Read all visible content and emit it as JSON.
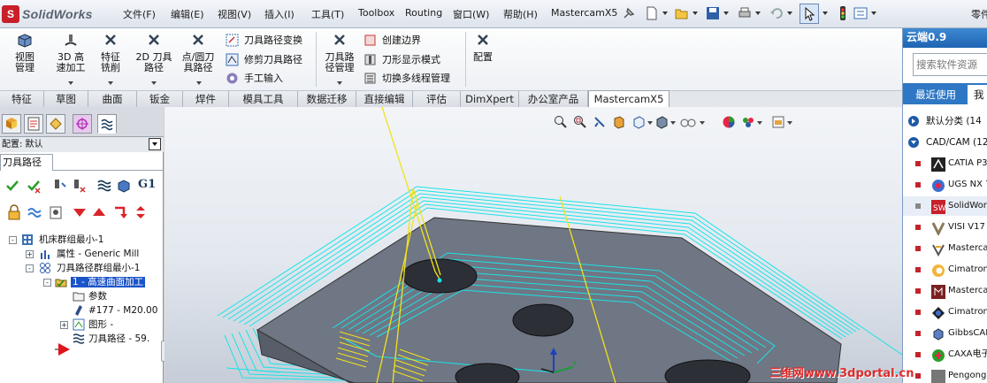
{
  "app": {
    "logo_text": "SolidWorks"
  },
  "menubar": {
    "items": [
      "文件(F)",
      "编辑(E)",
      "视图(V)",
      "插入(I)",
      "工具(T)",
      "Toolbox",
      "Routing",
      "窗口(W)",
      "帮助(H)",
      "MastercamX5"
    ],
    "right_cut_text": "零件"
  },
  "command_manager": {
    "big_buttons": [
      "视图管理",
      "3D 高速加工",
      "特征铣削",
      "2D 刀具路径",
      "点/圆刀具路径",
      "刀具路径管理",
      "配置"
    ],
    "small_buttons": [
      "刀具路径变换",
      "修剪刀具路径",
      "手工输入",
      "创建边界",
      "刀形显示模式",
      "切换多线程管理"
    ]
  },
  "tabs": [
    "特征",
    "草图",
    "曲面",
    "钣金",
    "焊件",
    "模具工具",
    "数据迁移",
    "直接编辑",
    "评估",
    "DimXpert",
    "办公室产品",
    "MastercamX5"
  ],
  "active_tab": "MastercamX5",
  "left_panel": {
    "config_label": "配置: 默认",
    "op_tab_label": "刀具路径",
    "tree": [
      {
        "label": "机床群组最小-1",
        "icon": "machine-group-icon"
      },
      {
        "label": "属性 - Generic Mill",
        "icon": "properties-icon"
      },
      {
        "label": "刀具路径群组最小-1",
        "icon": "toolpath-group-icon"
      },
      {
        "label": "1 - 高速曲面加工",
        "icon": "operation-folder-icon"
      },
      {
        "label": "参数",
        "icon": "parameters-icon"
      },
      {
        "label": "#177 - M20.00",
        "icon": "tool-icon"
      },
      {
        "label": "图形 -",
        "icon": "geometry-icon"
      },
      {
        "label": "刀具路径 - 59.",
        "icon": "toolpath-icon"
      }
    ]
  },
  "right_panel": {
    "header": "云端0.9",
    "search_placeholder": "搜索软件资源",
    "tabs": [
      "最近使用",
      "我"
    ],
    "categories": [
      "默认分类 (14",
      "CAD/CAM (12)"
    ],
    "apps": [
      "CATIA P3",
      "UGS NX 7",
      "SolidWorks",
      "VISI V17",
      "Mastercam",
      "Cimatron",
      "Mastercam",
      "Cimatron",
      "GibbsCAM",
      "CAXA电子",
      "Pengong"
    ]
  },
  "watermark": "三维网www.3dportal.cn",
  "colors": {
    "accent": "#2e77c4",
    "toolpath": "#19e3e6",
    "part": "#6f7684"
  }
}
